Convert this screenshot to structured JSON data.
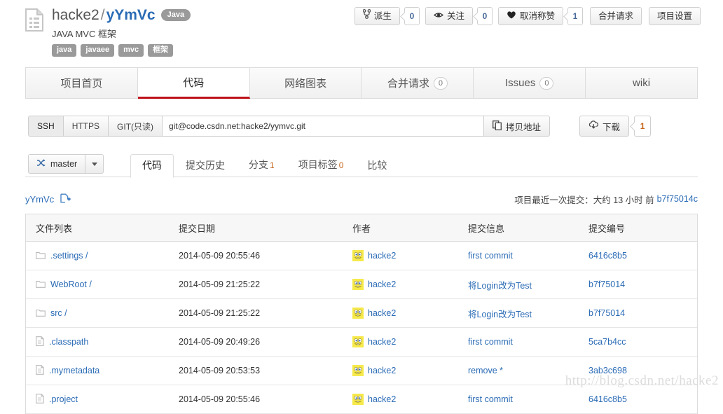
{
  "repo": {
    "owner": "hacke2",
    "separator": "/",
    "name": "yYmVc",
    "language_badge": "Java",
    "description": "JAVA MVC 框架",
    "tags": [
      "java",
      "javaee",
      "mvc",
      "框架"
    ],
    "doc_icon": "document-icon"
  },
  "actions": {
    "fork": {
      "label": "派生",
      "count": "0",
      "icon": "fork-icon"
    },
    "watch": {
      "label": "关注",
      "count": "0",
      "icon": "eye-icon"
    },
    "star": {
      "label": "取消称赞",
      "count": "1",
      "icon": "heart-icon"
    },
    "merge_request": "合并请求",
    "settings": "项目设置"
  },
  "main_tabs": [
    {
      "label": "项目首页",
      "count": null,
      "active": false
    },
    {
      "label": "代码",
      "count": null,
      "active": true
    },
    {
      "label": "网络图表",
      "count": null,
      "active": false
    },
    {
      "label": "合并请求",
      "count": "0",
      "active": false
    },
    {
      "label": "Issues",
      "count": "0",
      "active": false
    },
    {
      "label": "wiki",
      "count": null,
      "active": false
    }
  ],
  "clone": {
    "protocols": [
      {
        "label": "SSH",
        "active": true
      },
      {
        "label": "HTTPS",
        "active": false
      },
      {
        "label": "GIT(只读)",
        "active": false
      }
    ],
    "url": "git@code.csdn.net:hacke2/yymvc.git",
    "copy_label": "拷贝地址",
    "copy_icon": "copy-icon",
    "download_label": "下载",
    "download_icon": "cloud-download-icon",
    "download_count": "1"
  },
  "branch": {
    "name": "master",
    "icon": "branch-icon"
  },
  "sub_tabs": [
    {
      "label": "代码",
      "count": null,
      "active": true
    },
    {
      "label": "提交历史",
      "count": null,
      "active": false
    },
    {
      "label": "分支",
      "count": "1",
      "active": false
    },
    {
      "label": "项目标签",
      "count": "0",
      "active": false
    },
    {
      "label": "比较",
      "count": null,
      "active": false
    }
  ],
  "breadcrumb": {
    "root": "yYmVc",
    "new_file_icon": "new-file-icon"
  },
  "last_commit": {
    "label": "项目最近一次提交：大约 13 小时 前",
    "sha": "b7f75014c"
  },
  "file_table": {
    "headers": [
      "文件列表",
      "提交日期",
      "作者",
      "提交信息",
      "提交编号"
    ],
    "rows": [
      {
        "icon": "folder-icon",
        "name": ".settings /",
        "date": "2014-05-09 20:55:46",
        "author": "hacke2",
        "message": "first commit",
        "sha": "6416c8b5"
      },
      {
        "icon": "folder-icon",
        "name": "WebRoot /",
        "date": "2014-05-09 21:25:22",
        "author": "hacke2",
        "message": "将Login改为Test",
        "sha": "b7f75014"
      },
      {
        "icon": "folder-icon",
        "name": "src /",
        "date": "2014-05-09 21:25:22",
        "author": "hacke2",
        "message": "将Login改为Test",
        "sha": "b7f75014"
      },
      {
        "icon": "file-icon",
        "name": ".classpath",
        "date": "2014-05-09 20:49:26",
        "author": "hacke2",
        "message": "first commit",
        "sha": "5ca7b4cc"
      },
      {
        "icon": "file-icon",
        "name": ".mymetadata",
        "date": "2014-05-09 20:53:53",
        "author": "hacke2",
        "message": "remove *",
        "sha": "3ab3c698"
      },
      {
        "icon": "file-icon",
        "name": ".project",
        "date": "2014-05-09 20:55:46",
        "author": "hacke2",
        "message": "first commit",
        "sha": "6416c8b5"
      }
    ]
  },
  "watermark": "http://blog.csdn.net/hacke2",
  "colors": {
    "link": "#2a6bb5",
    "active_tab_underline": "#c0121a",
    "badge_gray": "#9a9a9a",
    "count_orange": "#c7651a",
    "avatar_yellow": "#f5e642"
  }
}
